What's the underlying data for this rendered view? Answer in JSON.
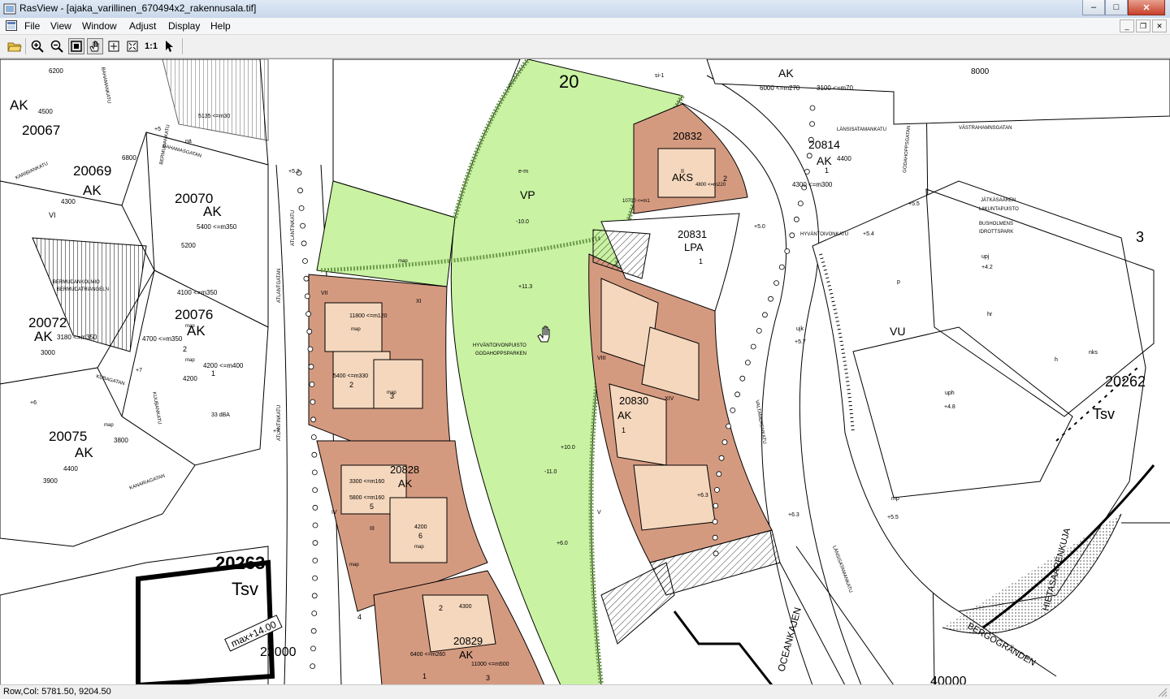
{
  "window": {
    "title": "RasView - [ajaka_varillinen_670494x2_rakennusala.tif]",
    "buttons": {
      "minimize": "–",
      "maximize": "□",
      "close": "✕"
    }
  },
  "menu": {
    "items": [
      "File",
      "View",
      "Window",
      "Adjust",
      "Display",
      "Help"
    ],
    "mdi_buttons": {
      "minimize": "_",
      "restore": "❐",
      "close": "✕"
    }
  },
  "toolbar": {
    "one_to_one_label": "1:1"
  },
  "status": {
    "text": "Row,Col: 5781.50, 9204.50"
  },
  "map": {
    "labels": {
      "block_20": "20",
      "vp": "VP",
      "b20832": "20832",
      "aks": "AKS",
      "b20831": "20831",
      "lpa": "LPA",
      "b20814": "20814",
      "ak_20814": "AK",
      "b20067": "20067",
      "ak_top_left": "AK",
      "b20069": "20069",
      "ak_20069": "AK",
      "b20070": "20070",
      "ak_20070": "AK",
      "b20072": "20072",
      "ak_20072": "AK",
      "b20076": "20076",
      "ak_20076": "AK",
      "b20075": "20075",
      "ak_20075": "AK",
      "b20828": "20828",
      "ak_20828": "AK",
      "b20830": "20830",
      "ak_20830": "AK",
      "b20829": "20829",
      "ak_20829": "AK",
      "b20263": "20263",
      "tsv_left": "Tsv",
      "b20262": "20262",
      "tsv_right": "Tsv",
      "vu": "VU",
      "ak_top": "AK",
      "n22000": "22000",
      "maxplus": "max+14.00",
      "n8000": "8000",
      "n40000": "40000",
      "n6200": "6200",
      "n4500": "4500",
      "n4300": "4300",
      "n5200": "5200",
      "n4700": "4700",
      "n4200": "4200",
      "n3000": "3000",
      "n3800": "3800",
      "n4400": "4400",
      "n3900": "3900",
      "n6800": "6800",
      "n11800": "11800 <=m120",
      "n5400": "5400 <=m330",
      "n3300": "3300 <=m160",
      "n5800": "5800 <=m160",
      "n4200b": "4200",
      "n4800": "4800 <=m220",
      "n10700": "10700 <=m1",
      "n5135": "5135 <=m30",
      "n6000": "6000 <=m270",
      "n3100": "3100 <=m70",
      "n4300b": "4300 <=m300",
      "n5400b": "5400 <=m350",
      "n3180": "3180 <=m350",
      "n4100": "4100 <=m350",
      "n4200c": "4200 <=m400",
      "n4700b": "4700 <=m350",
      "n4400b": "4400",
      "n11000": "11000 <=m500",
      "n6400": "6400 <=m260",
      "n4300c": "4300",
      "minus100": "-10.0",
      "plus113": "+11.3",
      "plus53": "+5.3",
      "plus5": "+5",
      "plus7": "+7",
      "plus7b": "+7",
      "plus6": "+6",
      "plus55": "+5.5",
      "plus57": "+5.7",
      "plus42": "+4.2",
      "plus48": "+4.8",
      "plus55b": "+5.5",
      "plus60": "+6.0",
      "plus63": "+6.3",
      "plus54": "+5.4",
      "plus50": "+5.0",
      "em": "e-m",
      "uph": "uph",
      "mp": "mp",
      "ujk": "ujk",
      "upj": "upj",
      "hr": "hr",
      "nks": "nks",
      "hyvanto": "HYVÄNTOIVONPUISTO",
      "godahopps": "GODAHOPPSPARKEN",
      "jatkasaari": "JÄTKÄSAAREN",
      "liikuntapuisto": "LIIKUNTAPUISTO",
      "bushomens": "BUSHOLMENS",
      "idrottspark": "IDROTTSPARK",
      "bermudan": "BERMUDANKOLMIO",
      "bermudatr": "BERMUDATRIANGELN",
      "atlantinkatu": "ATLANTINKATU",
      "atlantinkatu2": "ATLANTINKATU",
      "atlantgatan": "ATLANTGATAN",
      "bahamankatu": "BAHAMANKATU",
      "bahamasgatan": "BAHAMASGATAN",
      "kuubankatu": "KUUBANKATU",
      "kubagatan": "KUBAGATAN",
      "karibiankatu": "KARIBIANKATU",
      "kanariagatan": "KANARIAGATAN",
      "bermudankatu": "BERMUDANKATU",
      "hyvantoivonkatu": "HYVÄNTOIVONKATU",
      "lansisatamankatu": "LÄNSISATAMANKATU",
      "lansisatamankatu2": "LÄNSISATAMANKATU",
      "vastrahamngatan": "VÄSTRAHAMNSGATAN",
      "valtamerenkatu": "VALTAMERENKATU",
      "oceankajen": "OCEANKAJEN",
      "bergogranden": "BERGÖGRÄNDEN",
      "hietasaarenkuja": "HIETASAARENKUJA",
      "godahoppsgatan": "GODAHOPPSGATAN",
      "map": "map",
      "map2": "map",
      "map3": "map",
      "map4": "map",
      "map5": "map",
      "map6": "map",
      "map7": "map",
      "map8": "map",
      "num1": "1",
      "num2": "2",
      "num3": "3",
      "num4": "4",
      "num5": "5",
      "num6": "6",
      "num1b": "1",
      "num2b": "2",
      "num1c": "1",
      "num3b": "3",
      "num1d": "1",
      "num3c": "3",
      "num2c": "2",
      "roman_v": "V",
      "roman_vi": "VI",
      "roman_vii": "VII",
      "roman_viii": "VIII",
      "roman_xiv": "XIV",
      "roman_iii": "III",
      "roman_ii": "II",
      "roman_iv": "IV",
      "roman_xi": "XI",
      "plus100": "+10.0",
      "minus110": "-11.0",
      "plus60b": "+6.0",
      "plus63b": "+6.3",
      "dba33": "33 dBA",
      "na": "nä",
      "p": "p",
      "ph": "h",
      "si1": "si-1"
    }
  }
}
